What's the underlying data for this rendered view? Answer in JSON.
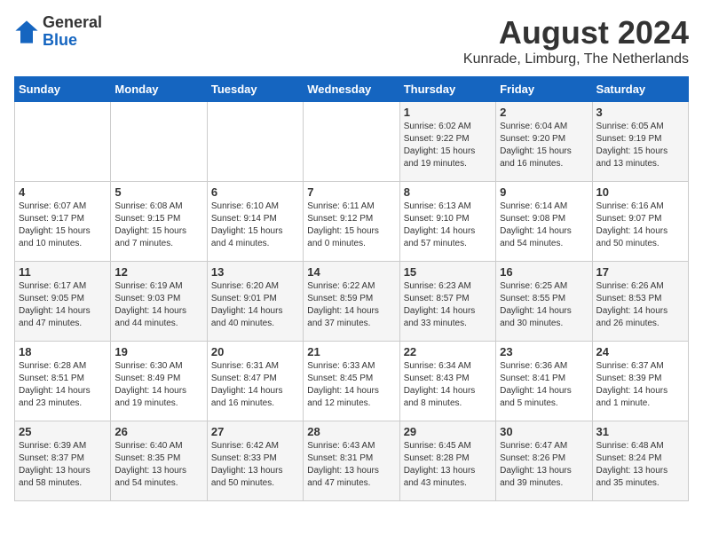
{
  "logo": {
    "general": "General",
    "blue": "Blue"
  },
  "header": {
    "month_year": "August 2024",
    "location": "Kunrade, Limburg, The Netherlands"
  },
  "days_of_week": [
    "Sunday",
    "Monday",
    "Tuesday",
    "Wednesday",
    "Thursday",
    "Friday",
    "Saturday"
  ],
  "weeks": [
    [
      {
        "day": "",
        "info": ""
      },
      {
        "day": "",
        "info": ""
      },
      {
        "day": "",
        "info": ""
      },
      {
        "day": "",
        "info": ""
      },
      {
        "day": "1",
        "info": "Sunrise: 6:02 AM\nSunset: 9:22 PM\nDaylight: 15 hours\nand 19 minutes."
      },
      {
        "day": "2",
        "info": "Sunrise: 6:04 AM\nSunset: 9:20 PM\nDaylight: 15 hours\nand 16 minutes."
      },
      {
        "day": "3",
        "info": "Sunrise: 6:05 AM\nSunset: 9:19 PM\nDaylight: 15 hours\nand 13 minutes."
      }
    ],
    [
      {
        "day": "4",
        "info": "Sunrise: 6:07 AM\nSunset: 9:17 PM\nDaylight: 15 hours\nand 10 minutes."
      },
      {
        "day": "5",
        "info": "Sunrise: 6:08 AM\nSunset: 9:15 PM\nDaylight: 15 hours\nand 7 minutes."
      },
      {
        "day": "6",
        "info": "Sunrise: 6:10 AM\nSunset: 9:14 PM\nDaylight: 15 hours\nand 4 minutes."
      },
      {
        "day": "7",
        "info": "Sunrise: 6:11 AM\nSunset: 9:12 PM\nDaylight: 15 hours\nand 0 minutes."
      },
      {
        "day": "8",
        "info": "Sunrise: 6:13 AM\nSunset: 9:10 PM\nDaylight: 14 hours\nand 57 minutes."
      },
      {
        "day": "9",
        "info": "Sunrise: 6:14 AM\nSunset: 9:08 PM\nDaylight: 14 hours\nand 54 minutes."
      },
      {
        "day": "10",
        "info": "Sunrise: 6:16 AM\nSunset: 9:07 PM\nDaylight: 14 hours\nand 50 minutes."
      }
    ],
    [
      {
        "day": "11",
        "info": "Sunrise: 6:17 AM\nSunset: 9:05 PM\nDaylight: 14 hours\nand 47 minutes."
      },
      {
        "day": "12",
        "info": "Sunrise: 6:19 AM\nSunset: 9:03 PM\nDaylight: 14 hours\nand 44 minutes."
      },
      {
        "day": "13",
        "info": "Sunrise: 6:20 AM\nSunset: 9:01 PM\nDaylight: 14 hours\nand 40 minutes."
      },
      {
        "day": "14",
        "info": "Sunrise: 6:22 AM\nSunset: 8:59 PM\nDaylight: 14 hours\nand 37 minutes."
      },
      {
        "day": "15",
        "info": "Sunrise: 6:23 AM\nSunset: 8:57 PM\nDaylight: 14 hours\nand 33 minutes."
      },
      {
        "day": "16",
        "info": "Sunrise: 6:25 AM\nSunset: 8:55 PM\nDaylight: 14 hours\nand 30 minutes."
      },
      {
        "day": "17",
        "info": "Sunrise: 6:26 AM\nSunset: 8:53 PM\nDaylight: 14 hours\nand 26 minutes."
      }
    ],
    [
      {
        "day": "18",
        "info": "Sunrise: 6:28 AM\nSunset: 8:51 PM\nDaylight: 14 hours\nand 23 minutes."
      },
      {
        "day": "19",
        "info": "Sunrise: 6:30 AM\nSunset: 8:49 PM\nDaylight: 14 hours\nand 19 minutes."
      },
      {
        "day": "20",
        "info": "Sunrise: 6:31 AM\nSunset: 8:47 PM\nDaylight: 14 hours\nand 16 minutes."
      },
      {
        "day": "21",
        "info": "Sunrise: 6:33 AM\nSunset: 8:45 PM\nDaylight: 14 hours\nand 12 minutes."
      },
      {
        "day": "22",
        "info": "Sunrise: 6:34 AM\nSunset: 8:43 PM\nDaylight: 14 hours\nand 8 minutes."
      },
      {
        "day": "23",
        "info": "Sunrise: 6:36 AM\nSunset: 8:41 PM\nDaylight: 14 hours\nand 5 minutes."
      },
      {
        "day": "24",
        "info": "Sunrise: 6:37 AM\nSunset: 8:39 PM\nDaylight: 14 hours\nand 1 minute."
      }
    ],
    [
      {
        "day": "25",
        "info": "Sunrise: 6:39 AM\nSunset: 8:37 PM\nDaylight: 13 hours\nand 58 minutes."
      },
      {
        "day": "26",
        "info": "Sunrise: 6:40 AM\nSunset: 8:35 PM\nDaylight: 13 hours\nand 54 minutes."
      },
      {
        "day": "27",
        "info": "Sunrise: 6:42 AM\nSunset: 8:33 PM\nDaylight: 13 hours\nand 50 minutes."
      },
      {
        "day": "28",
        "info": "Sunrise: 6:43 AM\nSunset: 8:31 PM\nDaylight: 13 hours\nand 47 minutes."
      },
      {
        "day": "29",
        "info": "Sunrise: 6:45 AM\nSunset: 8:28 PM\nDaylight: 13 hours\nand 43 minutes."
      },
      {
        "day": "30",
        "info": "Sunrise: 6:47 AM\nSunset: 8:26 PM\nDaylight: 13 hours\nand 39 minutes."
      },
      {
        "day": "31",
        "info": "Sunrise: 6:48 AM\nSunset: 8:24 PM\nDaylight: 13 hours\nand 35 minutes."
      }
    ]
  ]
}
